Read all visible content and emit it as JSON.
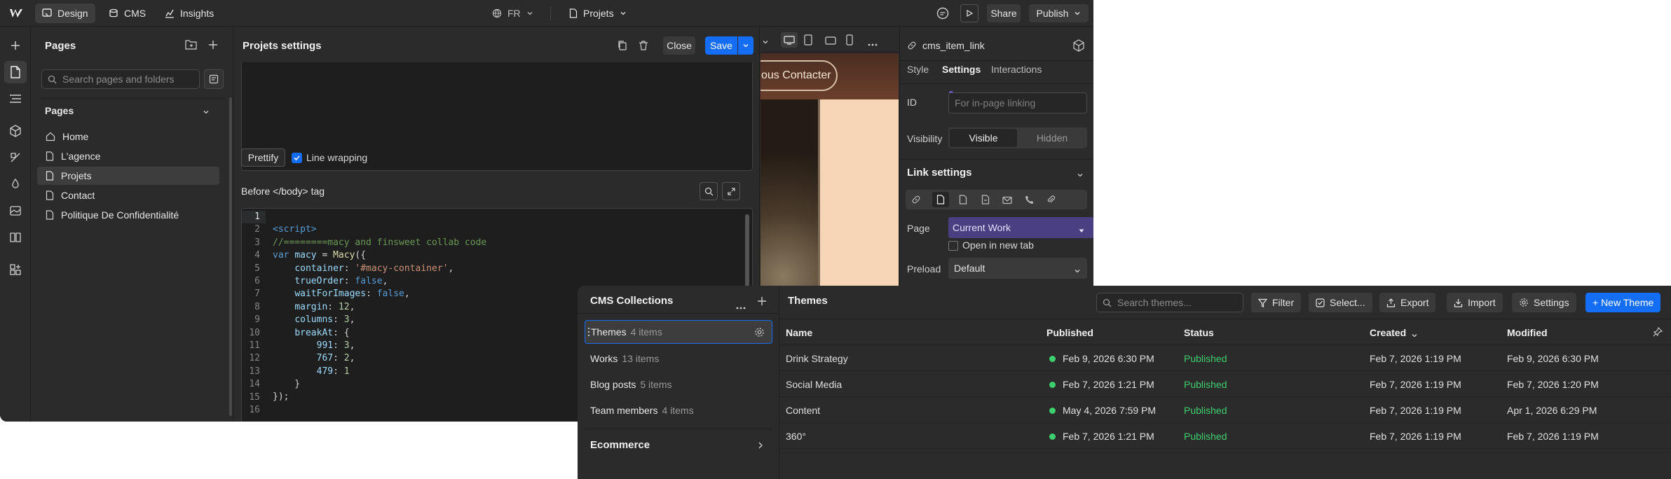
{
  "topbar": {
    "tabs": [
      {
        "label": "Design",
        "icon": "brush-icon"
      },
      {
        "label": "CMS",
        "icon": "database-icon"
      },
      {
        "label": "Insights",
        "icon": "chart-icon"
      }
    ],
    "locale": "FR",
    "page_selector": "Projets",
    "share_label": "Share",
    "publish_label": "Publish"
  },
  "pages_panel": {
    "title": "Pages",
    "search_placeholder": "Search pages and folders",
    "section_title": "Pages",
    "items": [
      {
        "label": "Home",
        "icon": "home-icon"
      },
      {
        "label": "L'agence",
        "icon": "page-icon"
      },
      {
        "label": "Projets",
        "icon": "page-icon"
      },
      {
        "label": "Contact",
        "icon": "page-icon"
      },
      {
        "label": "Politique De Confidentialité",
        "icon": "page-icon"
      }
    ]
  },
  "settings_panel": {
    "title": "Projets settings",
    "close_label": "Close",
    "save_label": "Save",
    "prettify_label": "Prettify",
    "line_wrapping_label": "Line wrapping",
    "before_body_label": "Before </body> tag",
    "code_lines": [
      "",
      "<script>",
      "//========macy and finsweet collab code",
      "var macy = Macy({",
      "    container: '#macy-container',",
      "    trueOrder: false,",
      "    waitForImages: false,",
      "    margin: 12,",
      "    columns: 3,",
      "    breakAt: {",
      "        991: 3,",
      "        767: 2,",
      "        479: 1",
      "    }",
      "});",
      ""
    ],
    "line_numbers": [
      "1",
      "2",
      "3",
      "4",
      "5",
      "6",
      "7",
      "8",
      "9",
      "10",
      "11",
      "12",
      "13",
      "14",
      "15",
      "16"
    ]
  },
  "preview": {
    "button_label": "Nous Contacter"
  },
  "right_panel": {
    "element_name": "cms_item_link",
    "tabs": [
      "Style",
      "Settings",
      "Interactions"
    ],
    "id_label": "ID",
    "id_placeholder": "For in-page linking",
    "visibility_label": "Visibility",
    "visible_label": "Visible",
    "hidden_label": "Hidden",
    "link_settings_title": "Link settings",
    "page_label": "Page",
    "page_value": "Current Work",
    "new_tab_label": "Open in new tab",
    "preload_label": "Preload",
    "preload_value": "Default"
  },
  "cms": {
    "title": "CMS Collections",
    "collections": [
      {
        "name": "Themes",
        "count": "4 items"
      },
      {
        "name": "Works",
        "count": "13 items"
      },
      {
        "name": "Blog posts",
        "count": "5 items"
      },
      {
        "name": "Team members",
        "count": "4 items"
      }
    ],
    "ecommerce_label": "Ecommerce",
    "table_title": "Themes",
    "search_placeholder": "Search themes...",
    "filter_label": "Filter",
    "select_label": "Select...",
    "export_label": "Export",
    "import_label": "Import",
    "settings_label": "Settings",
    "new_label": "+ New Theme",
    "columns": [
      "Name",
      "Published",
      "Status",
      "Created",
      "Modified"
    ],
    "rows": [
      {
        "name": "Drink Strategy",
        "published": "Feb 9, 2026 6:30 PM",
        "status": "Published",
        "created": "Feb 7, 2026 1:19 PM",
        "modified": "Feb 9, 2026 6:30 PM"
      },
      {
        "name": "Social Media",
        "published": "Feb 7, 2026 1:21 PM",
        "status": "Published",
        "created": "Feb 7, 2026 1:19 PM",
        "modified": "Feb 7, 2026 1:20 PM"
      },
      {
        "name": "Content",
        "published": "May 4, 2026 7:59 PM",
        "status": "Published",
        "created": "Feb 7, 2026 1:19 PM",
        "modified": "Apr 1, 2026 6:29 PM"
      },
      {
        "name": "360°",
        "published": "Feb 7, 2026 1:21 PM",
        "status": "Published",
        "created": "Feb 7, 2026 1:19 PM",
        "modified": "Feb 7, 2026 1:19 PM"
      }
    ]
  },
  "colors": {
    "accent": "#146ef5",
    "published": "#3ecf6e",
    "purple": "#7c5cff"
  }
}
